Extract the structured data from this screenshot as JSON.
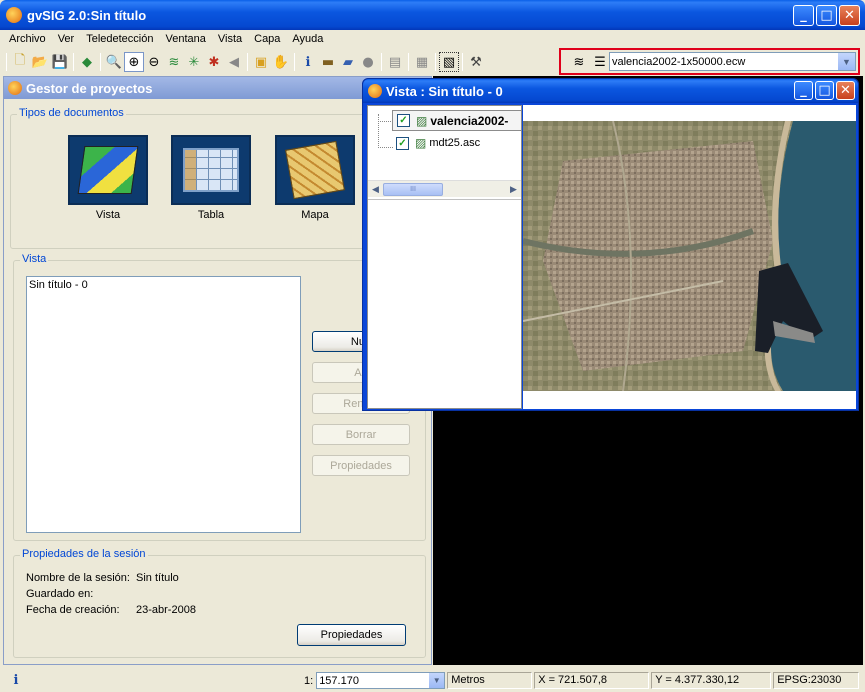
{
  "app": {
    "title": "gvSIG 2.0:Sin título"
  },
  "menu": [
    "Archivo",
    "Ver",
    "Teledetección",
    "Ventana",
    "Vista",
    "Capa",
    "Ayuda"
  ],
  "toolbar": {
    "layer_combo": "valencia2002-1x50000.ecw"
  },
  "project_manager": {
    "title": "Gestor de proyectos",
    "doc_types_label": "Tipos de documentos",
    "doc_types": [
      "Vista",
      "Tabla",
      "Mapa"
    ],
    "vista_group_label": "Vista",
    "vista_items": [
      "Sin título - 0"
    ],
    "buttons": {
      "nuevo": "Nue",
      "abrir": "Ab",
      "renombrar": "Renom",
      "borrar": "Borrar",
      "propiedades": "Propiedades"
    },
    "session": {
      "label": "Propiedades de la sesión",
      "name_label": "Nombre de la sesión:",
      "name_value": "Sin título",
      "saved_label": "Guardado en:",
      "saved_value": "",
      "date_label": "Fecha de creación:",
      "date_value": "23-abr-2008",
      "props_button": "Propiedades"
    }
  },
  "view_window": {
    "title": "Vista : Sin título - 0",
    "layers": [
      {
        "name": "valencia2002-",
        "checked": true,
        "bold": true
      },
      {
        "name": "mdt25.asc",
        "checked": true,
        "bold": false
      }
    ],
    "scroll_thumb": "III"
  },
  "status": {
    "info": "i",
    "scale_prefix": "1:",
    "scale": "157.170",
    "units": "Metros",
    "x": "X = 721.507,8",
    "y": "Y = 4.377.330,12",
    "epsg": "EPSG:23030"
  },
  "colors": {
    "highlight": "#e0001b",
    "accent": "#0046d5"
  }
}
